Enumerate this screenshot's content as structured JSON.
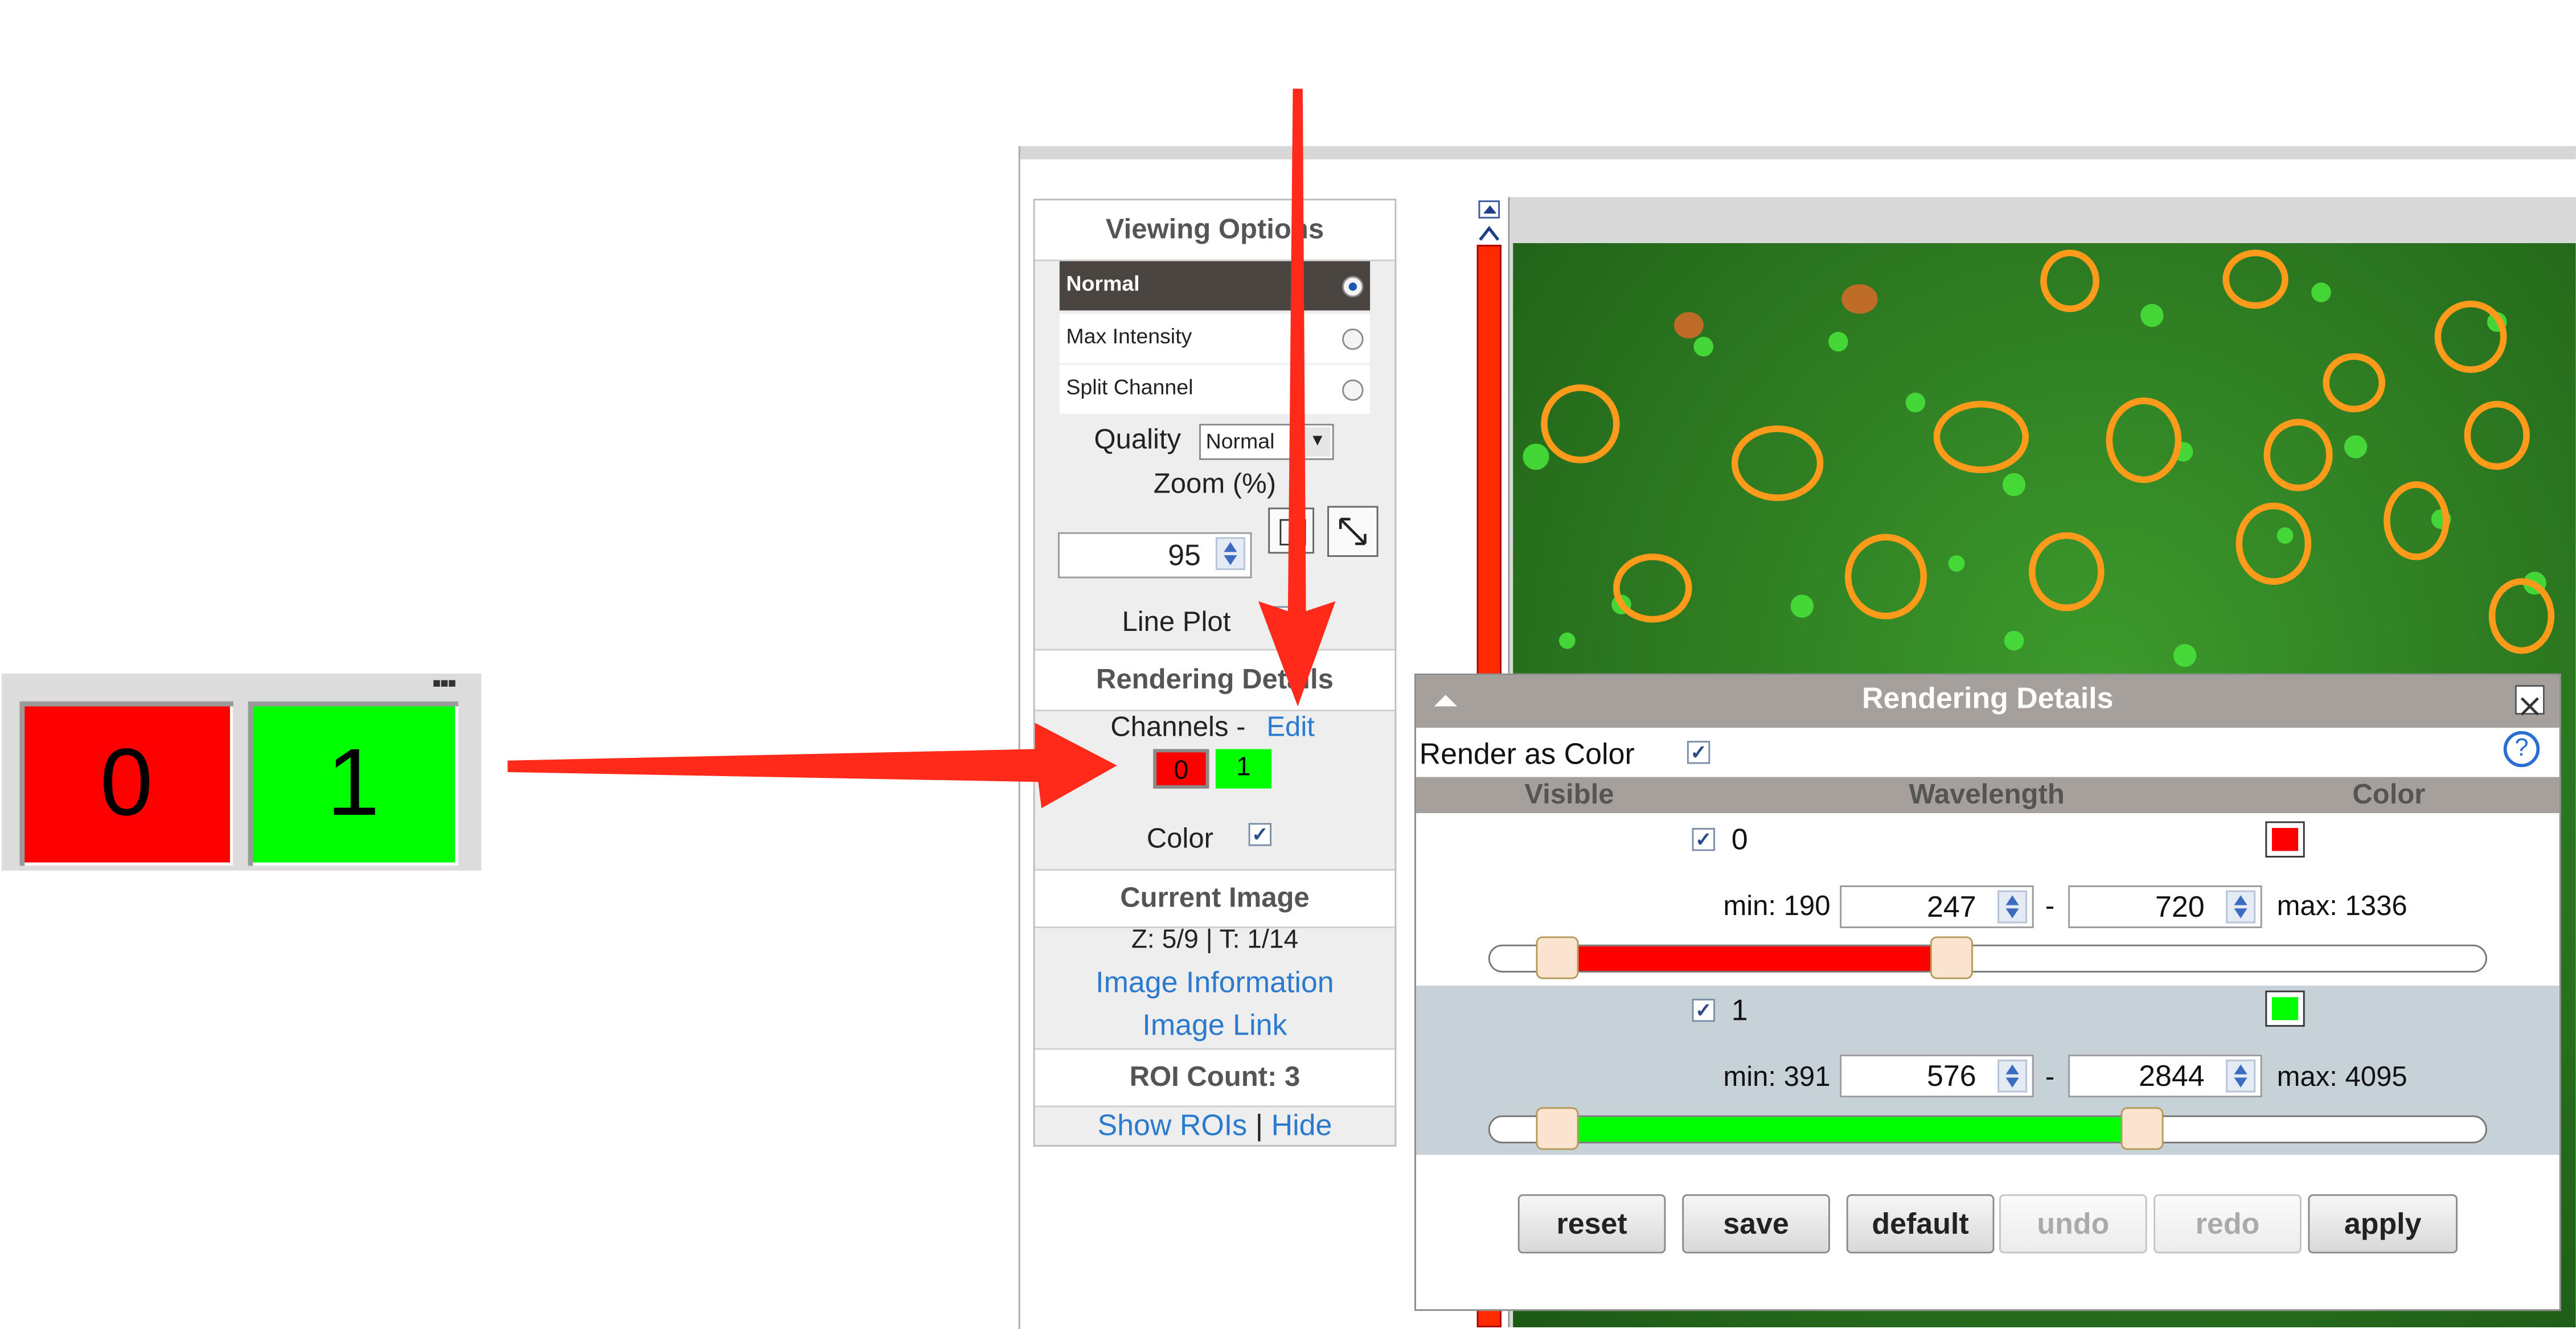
{
  "inset": {
    "channel_0": "0",
    "channel_1": "1"
  },
  "viewing_options": {
    "title": "Viewing Options",
    "modes": [
      {
        "label": "Normal",
        "selected": true
      },
      {
        "label": "Max Intensity",
        "selected": false
      },
      {
        "label": "Split Channel",
        "selected": false
      }
    ],
    "quality_label": "Quality",
    "quality_value": "Normal",
    "zoom_label": "Zoom (%)",
    "zoom_value": "95",
    "line_plot_label": "Line Plot"
  },
  "rendering_panel": {
    "title": "Rendering Details",
    "channels_label": "Channels -",
    "edit_link": "Edit",
    "channels": [
      "0",
      "1"
    ],
    "color_label": "Color"
  },
  "current_image": {
    "title": "Current Image",
    "position": "Z: 5/9 | T: 1/14",
    "info_link": "Image Information",
    "image_link": "Image Link"
  },
  "roi": {
    "count": "ROI Count: 3",
    "show_link": "Show ROIs",
    "separator": "|",
    "hide_link": "Hide"
  },
  "dialog": {
    "title": "Rendering Details",
    "render_as_color_label": "Render as Color",
    "col_visible": "Visible",
    "col_wavelength": "Wavelength",
    "col_color": "Color",
    "channels": [
      {
        "label": "0",
        "visible": true,
        "color": "#ff0000",
        "min_label": "min: 190",
        "start": "247",
        "dash": "-",
        "end": "720",
        "max_label": "max: 1336",
        "min": 190,
        "max": 1336,
        "start_value": 247,
        "end_value": 720
      },
      {
        "label": "1",
        "visible": true,
        "color": "#00ff00",
        "min_label": "min: 391",
        "start": "576",
        "dash": "-",
        "end": "2844",
        "max_label": "max: 4095",
        "min": 391,
        "max": 4095,
        "start_value": 576,
        "end_value": 2844
      }
    ],
    "buttons": {
      "reset": "reset",
      "save": "save",
      "default": "default",
      "undo": "undo",
      "redo": "redo",
      "apply": "apply"
    }
  },
  "colors": {
    "annotation_arrow": "#ff2a1a",
    "channel_red": "#ff0000",
    "channel_green": "#00ff00",
    "link": "#2a7bcf"
  }
}
